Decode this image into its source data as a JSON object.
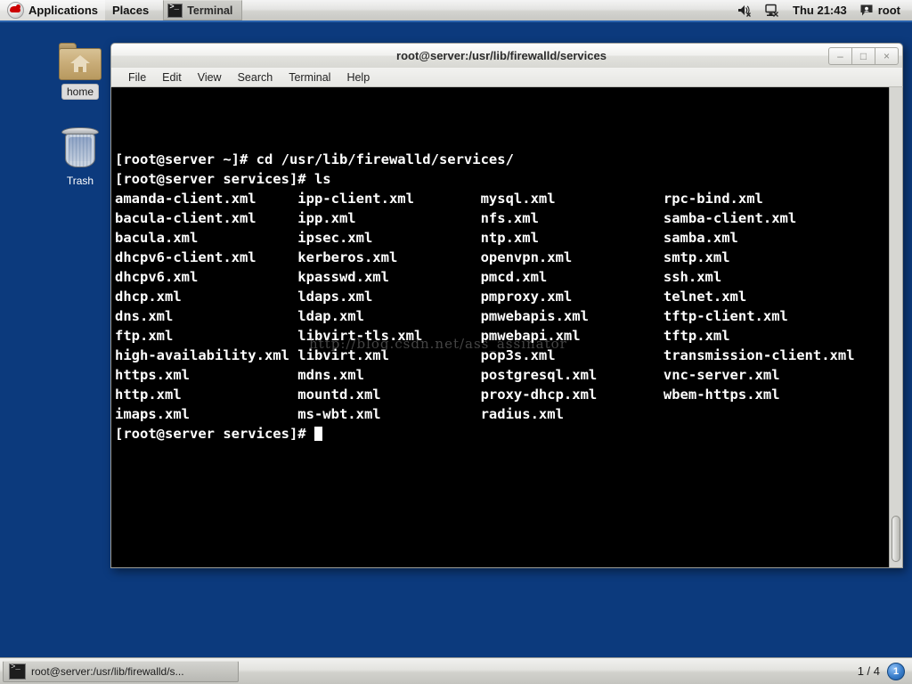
{
  "top_panel": {
    "applications_label": "Applications",
    "places_label": "Places",
    "window_task_label": "Terminal",
    "clock": "Thu 21:43",
    "user": "root",
    "icons": {
      "menu_logo": "redhat-logo-icon",
      "volume": "volume-muted-icon",
      "network": "network-disconnected-icon",
      "user": "user-account-icon"
    }
  },
  "desktop": {
    "icons": [
      {
        "name": "home",
        "label": "home",
        "glyph": "home-folder-icon"
      },
      {
        "name": "trash",
        "label": "Trash",
        "glyph": "trash-can-icon"
      }
    ]
  },
  "terminal": {
    "title": "root@server:/usr/lib/firewalld/services",
    "window_buttons": {
      "minimize": "–",
      "maximize": "□",
      "close": "×"
    },
    "menus": [
      "File",
      "Edit",
      "View",
      "Search",
      "Terminal",
      "Help"
    ],
    "prompt_home": "[root@server ~]#",
    "prompt_cwd": "[root@server services]#",
    "commands": {
      "cd": "cd /usr/lib/firewalld/services/",
      "ls": "ls"
    },
    "lines": [
      "[root@server ~]# cd /usr/lib/firewalld/services/",
      "[root@server services]# ls"
    ],
    "file_columns": [
      [
        "amanda-client.xml",
        "bacula-client.xml",
        "bacula.xml",
        "dhcpv6-client.xml",
        "dhcpv6.xml",
        "dhcp.xml",
        "dns.xml",
        "ftp.xml",
        "high-availability.xml",
        "https.xml",
        "http.xml",
        "imaps.xml"
      ],
      [
        "ipp-client.xml",
        "ipp.xml",
        "ipsec.xml",
        "kerberos.xml",
        "kpasswd.xml",
        "ldaps.xml",
        "ldap.xml",
        "libvirt-tls.xml",
        "libvirt.xml",
        "mdns.xml",
        "mountd.xml",
        "ms-wbt.xml"
      ],
      [
        "mysql.xml",
        "nfs.xml",
        "ntp.xml",
        "openvpn.xml",
        "pmcd.xml",
        "pmproxy.xml",
        "pmwebapis.xml",
        "pmwebapi.xml",
        "pop3s.xml",
        "postgresql.xml",
        "proxy-dhcp.xml",
        "radius.xml"
      ],
      [
        "rpc-bind.xml",
        "samba-client.xml",
        "samba.xml",
        "smtp.xml",
        "ssh.xml",
        "telnet.xml",
        "tftp-client.xml",
        "tftp.xml",
        "transmission-client.xml",
        "vnc-server.xml",
        "wbem-https.xml",
        ""
      ]
    ],
    "final_prompt": "[root@server services]# ",
    "watermark": "http://blog.csdn.net/ass_assinator"
  },
  "bottom_panel": {
    "task_label": "root@server:/usr/lib/firewalld/s...",
    "workspace_indicator": "1 / 4",
    "workspace_badge": "1"
  },
  "colors": {
    "desktop_background": "#0c3a7d",
    "terminal_background": "#000000",
    "terminal_foreground": "#ffffff",
    "panel_accent": "#2a63ae",
    "redhat_red": "#cc0000"
  }
}
